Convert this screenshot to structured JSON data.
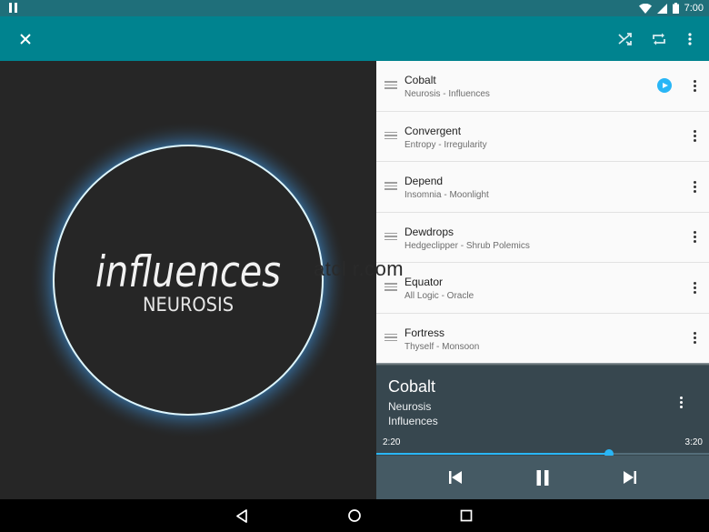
{
  "status_bar": {
    "time": "7:00",
    "icons": [
      "pause-icon",
      "wifi-icon",
      "signal-icon",
      "battery-icon"
    ]
  },
  "toolbar": {
    "icons": [
      "close-icon",
      "shuffle-icon",
      "repeat-icon",
      "more-vert-icon"
    ]
  },
  "album_art": {
    "title": "influences",
    "artist": "NEUROSIS",
    "watermark": "atcl  r.com"
  },
  "queue": [
    {
      "title": "Cobalt",
      "subtitle": "Neurosis - Influences",
      "playing": true
    },
    {
      "title": "Convergent",
      "subtitle": "Entropy - Irregularity",
      "playing": false
    },
    {
      "title": "Depend",
      "subtitle": "Insomnia - Moonlight",
      "playing": false
    },
    {
      "title": "Dewdrops",
      "subtitle": "Hedgeclipper - Shrub Polemics",
      "playing": false
    },
    {
      "title": "Equator",
      "subtitle": "All Logic - Oracle",
      "playing": false
    },
    {
      "title": "Fortress",
      "subtitle": "Thyself - Monsoon",
      "playing": false
    }
  ],
  "now_playing": {
    "title": "Cobalt",
    "artist": "Neurosis",
    "album": "Influences",
    "current_time": "2:20",
    "duration": "3:20",
    "progress_fraction": 0.7
  },
  "nav_bar": {
    "icons": [
      "back-icon",
      "home-icon",
      "recents-icon"
    ]
  },
  "colors": {
    "status_bar": "#1f6f7a",
    "toolbar": "#00838f",
    "accent": "#29b6f6",
    "now_playing_bg": "#37474f",
    "controls_bg": "#455a64",
    "list_bg": "#fafafa"
  }
}
